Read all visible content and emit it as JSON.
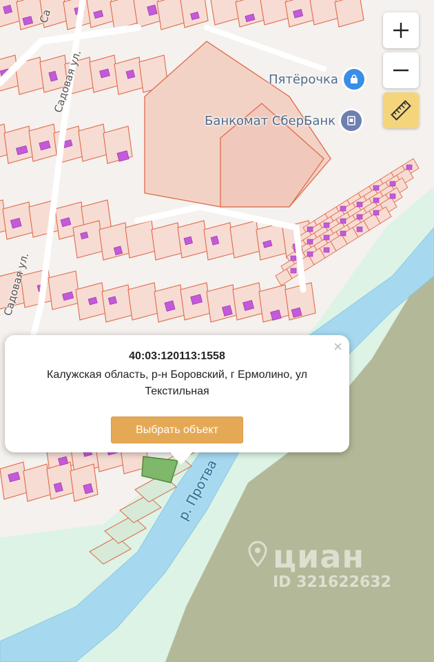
{
  "colors": {
    "parcel_fill": "#f7dcd3",
    "parcel_stroke": "#e06a4a",
    "building": "#c45ad9",
    "river": "#a6d9ef",
    "bank_strip": "#dcf3e5",
    "forest": "#b3b998",
    "road": "#ffffff",
    "button": "#e5a955",
    "ruler_button": "#f4d57c"
  },
  "streets": [
    {
      "label": "Садовая ул."
    },
    {
      "label": "Садовая ул."
    },
    {
      "label": "Са"
    }
  ],
  "river_label": "р. Протва",
  "pois": [
    {
      "label": "Пятёрочка",
      "icon": "shopping-bag-icon"
    },
    {
      "label": "Банкомат СберБанк",
      "icon": "atm-icon"
    }
  ],
  "controls": {
    "zoom_in": "+",
    "zoom_out": "−",
    "ruler_icon": "ruler-icon"
  },
  "popup": {
    "close": "×",
    "cadastral_number": "40:03:120113:1558",
    "address": "Калужская область, р-н Боровский, г Ермолино, ул Текстильная",
    "button_label": "Выбрать объект"
  },
  "watermark": {
    "brand": "циан",
    "id": "ID 321622632"
  }
}
